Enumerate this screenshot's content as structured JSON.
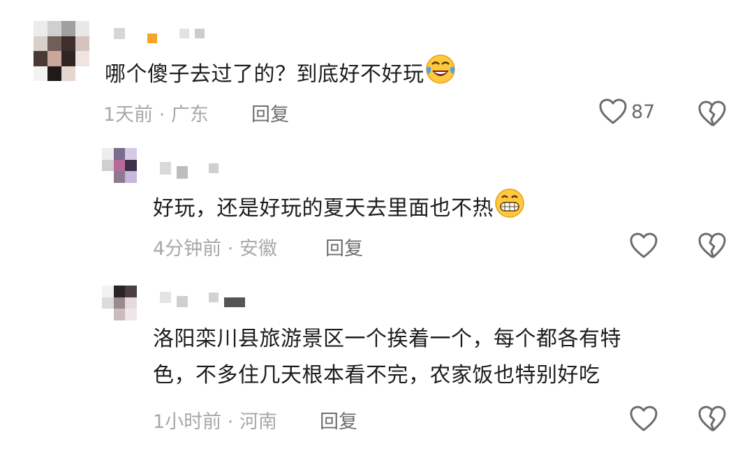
{
  "comments": [
    {
      "text": "哪个傻子去过了的？到底好不好玩",
      "emoji": "face-with-tears-of-joy",
      "time": "1天前",
      "location": "广东",
      "reply_label": "回复",
      "likes": "87",
      "user_name_blurred": true
    },
    {
      "text": "好玩，还是好玩的夏天去里面也不热",
      "emoji": "grinning-face",
      "time": "4分钟前",
      "location": "安徽",
      "reply_label": "回复",
      "likes": "",
      "user_name_blurred": true
    },
    {
      "text_line1": "洛阳栾川县旅游景区一个挨着一个，每个都各有特",
      "text_line2": "色，不多住几天根本看不完，农家饭也特别好吃",
      "time": "1小时前",
      "location": "河南",
      "reply_label": "回复",
      "likes": "",
      "user_name_blurred": true
    }
  ],
  "colors": {
    "text": "#1c1c1c",
    "meta": "#a8a8a8",
    "reply": "#6e6e6e",
    "icon": "#6b6b6b",
    "name_accent": "#f5a623"
  },
  "icons": {
    "like": "heart-outline-icon",
    "dislike": "broken-heart-icon"
  }
}
